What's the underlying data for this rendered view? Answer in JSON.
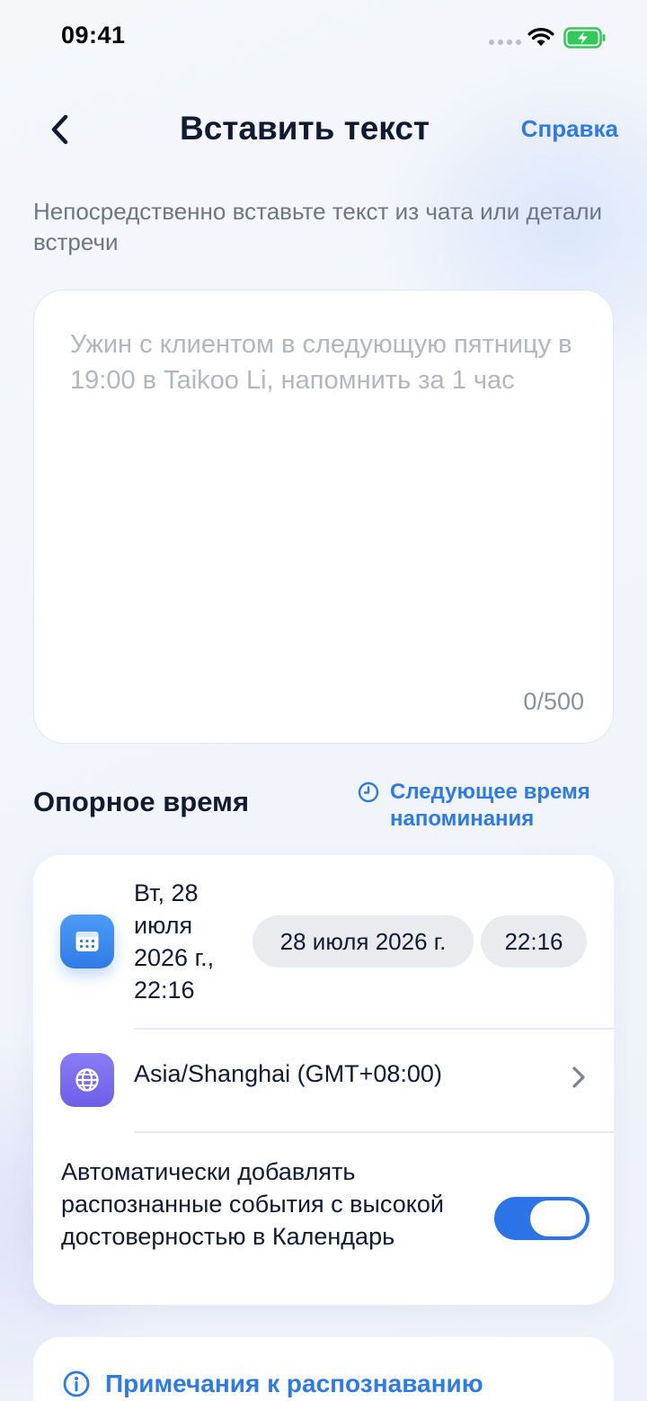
{
  "status_bar": {
    "time": "09:41"
  },
  "nav": {
    "title": "Вставить текст",
    "help_label": "Справка",
    "back_icon": "chevron-left-icon"
  },
  "subtitle": "Непосредственно вставьте текст из чата или детали встречи",
  "text_input": {
    "value": "",
    "placeholder": "Ужин с клиентом в следующую пятницу в 19:00 в Taikoo Li, напомнить за 1 час",
    "counter": "0/500"
  },
  "reference_time": {
    "title": "Опорное время",
    "next_reminder_label": "Следующее время напоминания",
    "date_summary": "Вт, 28 июля 2026 г., 22:16",
    "date_pill": "28 июля 2026 г.",
    "time_pill": "22:16",
    "timezone": "Asia/Shanghai (GMT+08:00)",
    "auto_add_label": "Автоматически добавлять распознанные события с высокой достоверностью в Календарь",
    "auto_add_enabled": true
  },
  "notes": {
    "title": "Примечания к распознаванию"
  },
  "colors": {
    "accent": "#2F7BE6",
    "toggle_on": "#2B74E8",
    "battery_green": "#34C759",
    "calendar_icon_bg": "#2F7BE6",
    "globe_icon_bg": "#6D60E9"
  }
}
